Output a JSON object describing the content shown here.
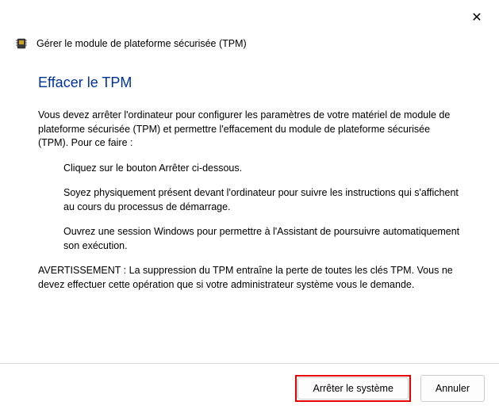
{
  "window": {
    "title": "Gérer le module de plateforme sécurisée (TPM)"
  },
  "content": {
    "heading": "Effacer le TPM",
    "intro": "Vous devez arrêter l'ordinateur pour configurer les paramètres de votre matériel de module de plateforme sécurisée (TPM) et permettre l'effacement du module de plateforme sécurisée (TPM). Pour ce faire :",
    "steps": [
      "Cliquez sur le bouton Arrêter ci-dessous.",
      "Soyez physiquement présent devant l'ordinateur pour suivre les instructions qui s'affichent au cours du processus de démarrage.",
      "Ouvrez une session Windows pour permettre à l'Assistant de poursuivre automatiquement son exécution."
    ],
    "warning": "AVERTISSEMENT : La suppression du TPM entraîne la perte de toutes les clés TPM. Vous ne devez effectuer cette opération que si votre administrateur système vous le demande."
  },
  "footer": {
    "shutdown_label": "Arrêter le système",
    "cancel_label": "Annuler"
  },
  "icons": {
    "close": "✕",
    "tpm": "tpm-chip-icon"
  }
}
